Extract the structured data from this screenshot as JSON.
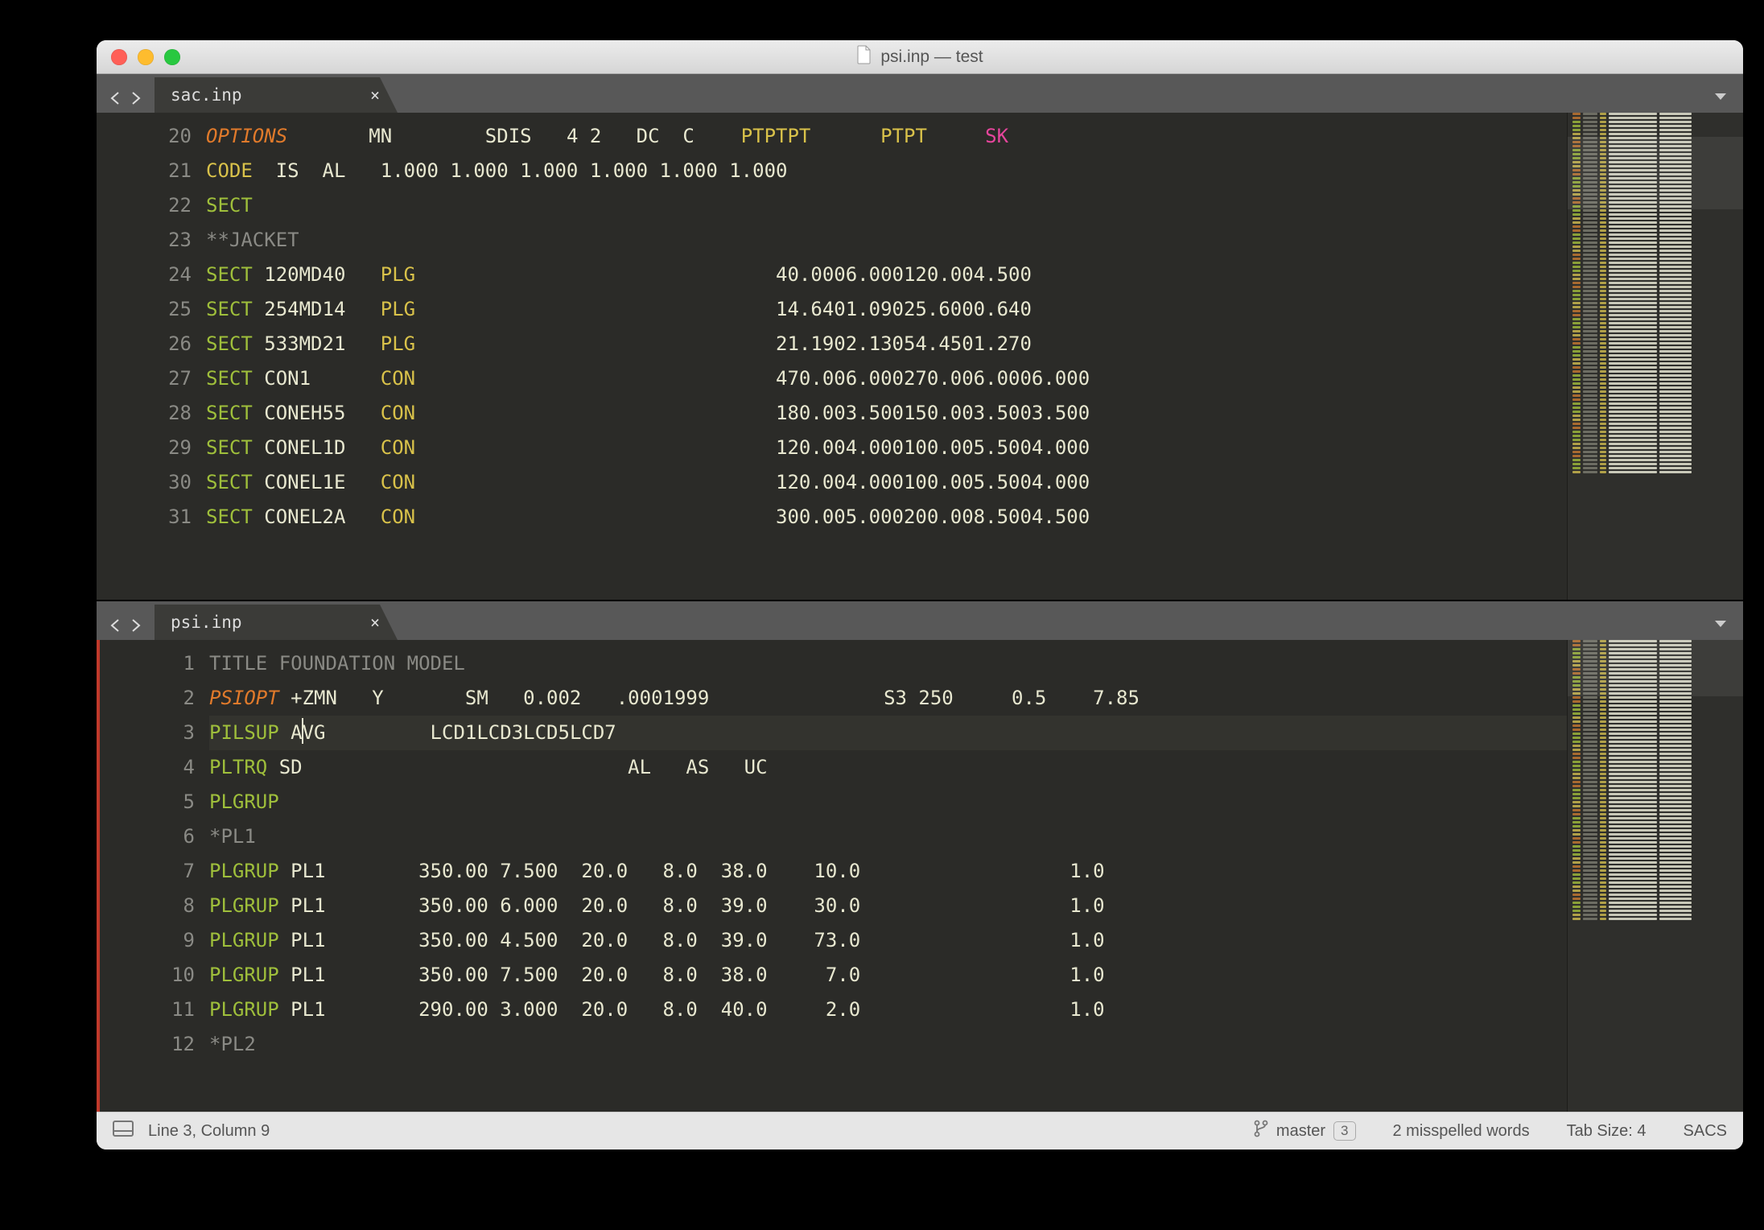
{
  "window": {
    "title": "psi.inp — test"
  },
  "panes": {
    "top": {
      "tab": "sac.inp",
      "first_line_no": 20,
      "lines": [
        {
          "n": 20,
          "segs": [
            {
              "cls": "kw-i",
              "t": "OPTIONS"
            },
            {
              "cls": "",
              "t": "       MN        SDIS   4 2   DC  C    "
            },
            {
              "cls": "kw-y",
              "t": "PTPTPT"
            },
            {
              "cls": "",
              "t": "      "
            },
            {
              "cls": "kw-y",
              "t": "PTPT"
            },
            {
              "cls": "",
              "t": "     "
            },
            {
              "cls": "pk",
              "t": "SK"
            }
          ]
        },
        {
          "n": 21,
          "segs": [
            {
              "cls": "kw-y",
              "t": "CODE"
            },
            {
              "cls": "",
              "t": "  IS  AL   1.000 1.000 1.000 1.000 1.000 1.000"
            }
          ]
        },
        {
          "n": 22,
          "segs": [
            {
              "cls": "kw-g",
              "t": "SECT"
            }
          ]
        },
        {
          "n": 23,
          "segs": [
            {
              "cls": "cmt",
              "t": "**JACKET"
            }
          ]
        },
        {
          "n": 24,
          "segs": [
            {
              "cls": "kw-g",
              "t": "SECT"
            },
            {
              "cls": "",
              "t": " 120MD40   "
            },
            {
              "cls": "kw-y",
              "t": "PLG"
            },
            {
              "cls": "",
              "t": "                               40.0006.000120.004.500"
            }
          ]
        },
        {
          "n": 25,
          "segs": [
            {
              "cls": "kw-g",
              "t": "SECT"
            },
            {
              "cls": "",
              "t": " 254MD14   "
            },
            {
              "cls": "kw-y",
              "t": "PLG"
            },
            {
              "cls": "",
              "t": "                               14.6401.09025.6000.640"
            }
          ]
        },
        {
          "n": 26,
          "segs": [
            {
              "cls": "kw-g",
              "t": "SECT"
            },
            {
              "cls": "",
              "t": " 533MD21   "
            },
            {
              "cls": "kw-y",
              "t": "PLG"
            },
            {
              "cls": "",
              "t": "                               21.1902.13054.4501.270"
            }
          ]
        },
        {
          "n": 27,
          "segs": [
            {
              "cls": "kw-g",
              "t": "SECT"
            },
            {
              "cls": "",
              "t": " CON1      "
            },
            {
              "cls": "kw-y",
              "t": "CON"
            },
            {
              "cls": "",
              "t": "                               470.006.000270.006.0006.000"
            }
          ]
        },
        {
          "n": 28,
          "segs": [
            {
              "cls": "kw-g",
              "t": "SECT"
            },
            {
              "cls": "",
              "t": " CONEH55   "
            },
            {
              "cls": "kw-y",
              "t": "CON"
            },
            {
              "cls": "",
              "t": "                               180.003.500150.003.5003.500"
            }
          ]
        },
        {
          "n": 29,
          "segs": [
            {
              "cls": "kw-g",
              "t": "SECT"
            },
            {
              "cls": "",
              "t": " CONEL1D   "
            },
            {
              "cls": "kw-y",
              "t": "CON"
            },
            {
              "cls": "",
              "t": "                               120.004.000100.005.5004.000"
            }
          ]
        },
        {
          "n": 30,
          "segs": [
            {
              "cls": "kw-g",
              "t": "SECT"
            },
            {
              "cls": "",
              "t": " CONEL1E   "
            },
            {
              "cls": "kw-y",
              "t": "CON"
            },
            {
              "cls": "",
              "t": "                               120.004.000100.005.5004.000"
            }
          ]
        },
        {
          "n": 31,
          "segs": [
            {
              "cls": "kw-g",
              "t": "SECT"
            },
            {
              "cls": "",
              "t": " CONEL2A   "
            },
            {
              "cls": "kw-y",
              "t": "CON"
            },
            {
              "cls": "",
              "t": "                               300.005.000200.008.5004.500"
            }
          ]
        }
      ]
    },
    "bottom": {
      "tab": "psi.inp",
      "first_line_no": 1,
      "active_line_no": 3,
      "lines": [
        {
          "n": 1,
          "segs": [
            {
              "cls": "cmt",
              "t": "TITLE FOUNDATION MODEL"
            }
          ]
        },
        {
          "n": 2,
          "segs": [
            {
              "cls": "kw-i",
              "t": "PSIOPT"
            },
            {
              "cls": "",
              "t": " +ZMN   Y       SM   0.002   .0001999               S3 250     0.5    7.85"
            }
          ]
        },
        {
          "n": 3,
          "hl": true,
          "segs": [
            {
              "cls": "kw-g",
              "t": "PILSUP"
            },
            {
              "cls": "",
              "t": " A"
            },
            {
              "cls": "caret",
              "t": ""
            },
            {
              "cls": "",
              "t": "VG         LCD1LCD3LCD5LCD7"
            }
          ]
        },
        {
          "n": 4,
          "segs": [
            {
              "cls": "kw-g",
              "t": "PLTRQ"
            },
            {
              "cls": "",
              "t": " SD                            AL   AS   UC"
            }
          ]
        },
        {
          "n": 5,
          "segs": [
            {
              "cls": "kw-g",
              "t": "PLGRUP"
            }
          ]
        },
        {
          "n": 6,
          "segs": [
            {
              "cls": "cmt",
              "t": "*PL1"
            }
          ]
        },
        {
          "n": 7,
          "segs": [
            {
              "cls": "kw-g",
              "t": "PLGRUP"
            },
            {
              "cls": "",
              "t": " PL1        350.00 7.500  20.0   8.0  38.0    10.0                  1.0"
            }
          ]
        },
        {
          "n": 8,
          "segs": [
            {
              "cls": "kw-g",
              "t": "PLGRUP"
            },
            {
              "cls": "",
              "t": " PL1        350.00 6.000  20.0   8.0  39.0    30.0                  1.0"
            }
          ]
        },
        {
          "n": 9,
          "segs": [
            {
              "cls": "kw-g",
              "t": "PLGRUP"
            },
            {
              "cls": "",
              "t": " PL1        350.00 4.500  20.0   8.0  39.0    73.0                  1.0"
            }
          ]
        },
        {
          "n": 10,
          "segs": [
            {
              "cls": "kw-g",
              "t": "PLGRUP"
            },
            {
              "cls": "",
              "t": " PL1        350.00 7.500  20.0   8.0  38.0     7.0                  1.0"
            }
          ]
        },
        {
          "n": 11,
          "segs": [
            {
              "cls": "kw-g",
              "t": "PLGRUP"
            },
            {
              "cls": "",
              "t": " PL1        290.00 3.000  20.0   8.0  40.0     2.0                  1.0"
            }
          ]
        },
        {
          "n": 12,
          "segs": [
            {
              "cls": "cmt",
              "t": "*PL2"
            }
          ]
        }
      ]
    }
  },
  "status": {
    "position": "Line 3, Column 9",
    "git_branch": "master",
    "git_count": "3",
    "spell": "2 misspelled words",
    "indent": "Tab Size: 4",
    "syntax": "SACS"
  }
}
